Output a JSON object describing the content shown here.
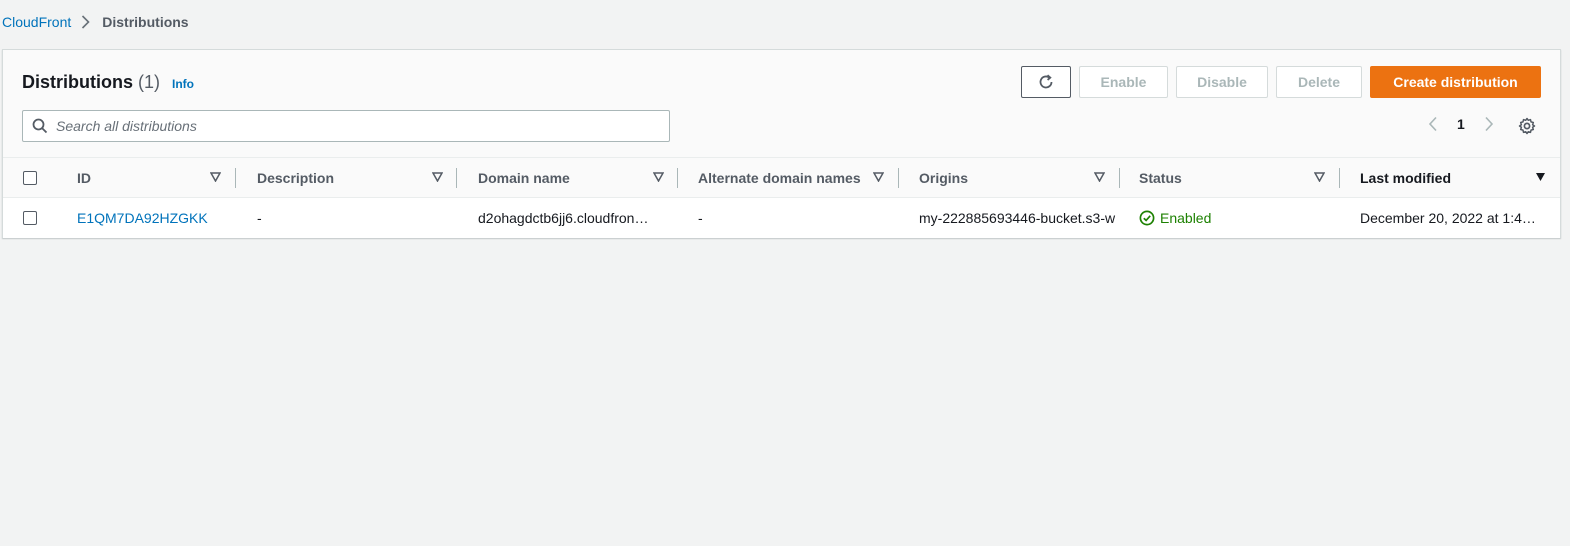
{
  "breadcrumb": {
    "root": "CloudFront",
    "current": "Distributions"
  },
  "header": {
    "title": "Distributions",
    "count": "(1)",
    "info": "Info"
  },
  "toolbar": {
    "enable_label": "Enable",
    "disable_label": "Disable",
    "delete_label": "Delete",
    "create_label": "Create distribution",
    "create_color": "#ec7211"
  },
  "search": {
    "placeholder": "Search all distributions",
    "value": ""
  },
  "pagination": {
    "current_page": "1"
  },
  "table": {
    "columns": [
      "ID",
      "Description",
      "Domain name",
      "Alternate domain names",
      "Origins",
      "Status",
      "Last modified"
    ],
    "rows": [
      {
        "id": "E1QM7DA92HZGKK",
        "description": "-",
        "domain_name": "d2ohagdctb6jj6.cloudfron…",
        "alternate_domain_names": "-",
        "origins": "my-222885693446-bucket.s3-w",
        "status": "Enabled",
        "last_modified": "December 20, 2022 at 1:4…"
      }
    ]
  },
  "icons": {
    "refresh": "refresh-icon",
    "search": "search-icon",
    "settings": "gear-icon",
    "status": "check-circle-icon"
  }
}
